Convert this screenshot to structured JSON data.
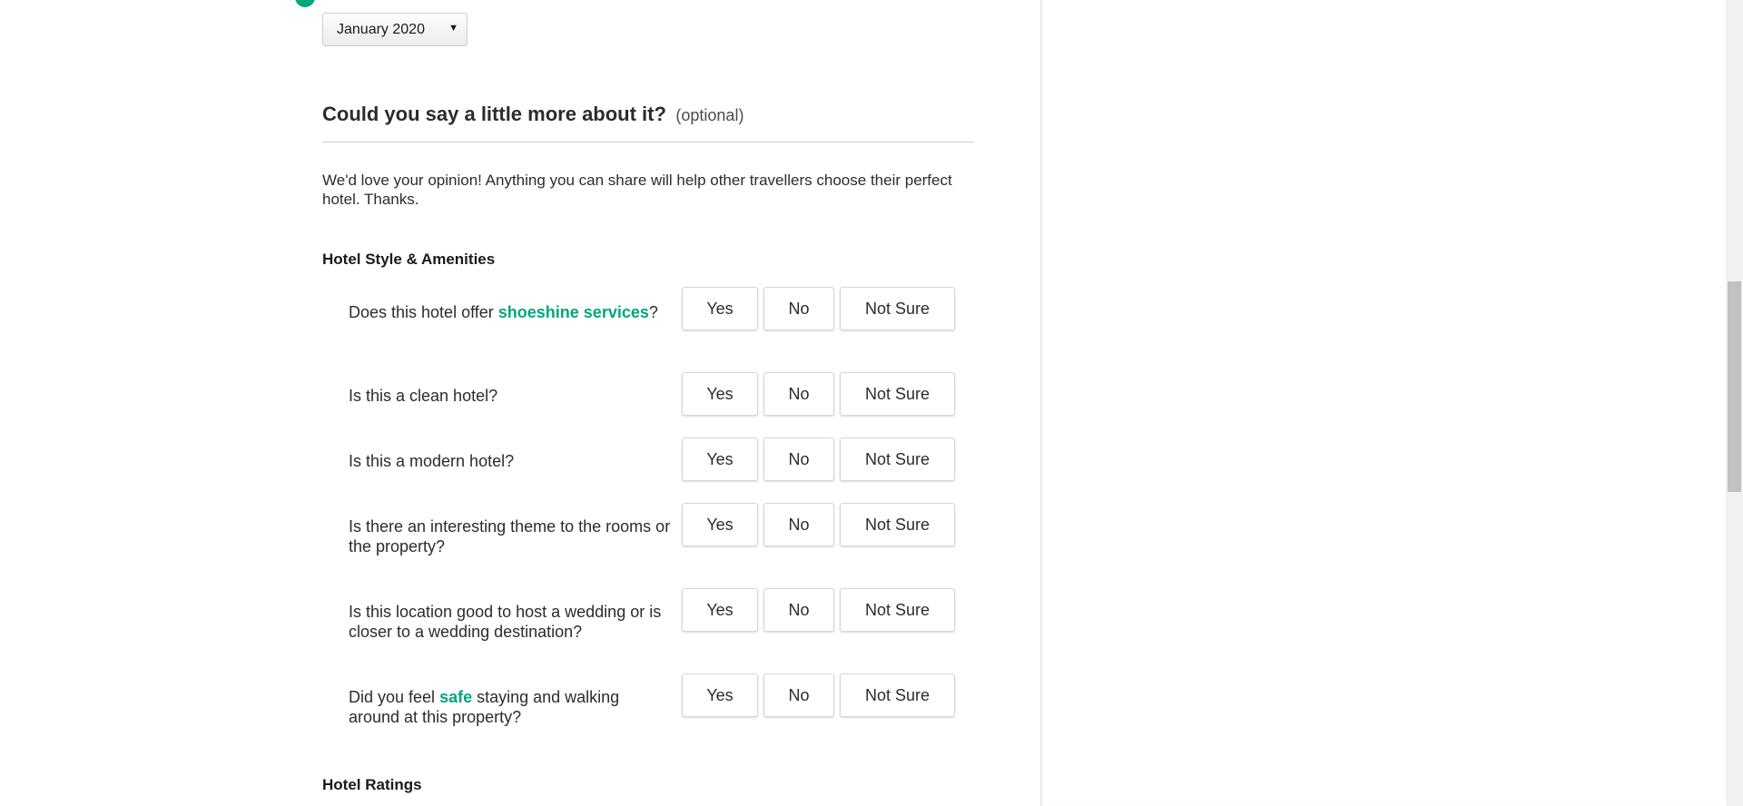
{
  "date_select": {
    "value": "January 2020"
  },
  "section": {
    "title": "Could you say a little more about it?",
    "optional": "(optional)",
    "intro": "We'd love your opinion! Anything you can share will help other travellers choose their perfect hotel. Thanks."
  },
  "groups": {
    "style_amenities": "Hotel Style & Amenities",
    "ratings": "Hotel Ratings"
  },
  "answers": {
    "yes": "Yes",
    "no": "No",
    "not_sure": "Not Sure"
  },
  "questions": [
    {
      "before": "Does this hotel offer ",
      "highlight": "shoeshine services",
      "after": "?"
    },
    {
      "before": "Is this a clean hotel?",
      "highlight": "",
      "after": ""
    },
    {
      "before": "Is this a modern hotel?",
      "highlight": "",
      "after": ""
    },
    {
      "before": "Is there an interesting theme to the rooms or the property?",
      "highlight": "",
      "after": ""
    },
    {
      "before": "Is this location good to host a wedding or is closer to a wedding destination?",
      "highlight": "",
      "after": ""
    },
    {
      "before": "Did you feel ",
      "highlight": "safe",
      "after": " staying and walking around at this property?"
    }
  ],
  "colors": {
    "accent": "#00a680"
  }
}
